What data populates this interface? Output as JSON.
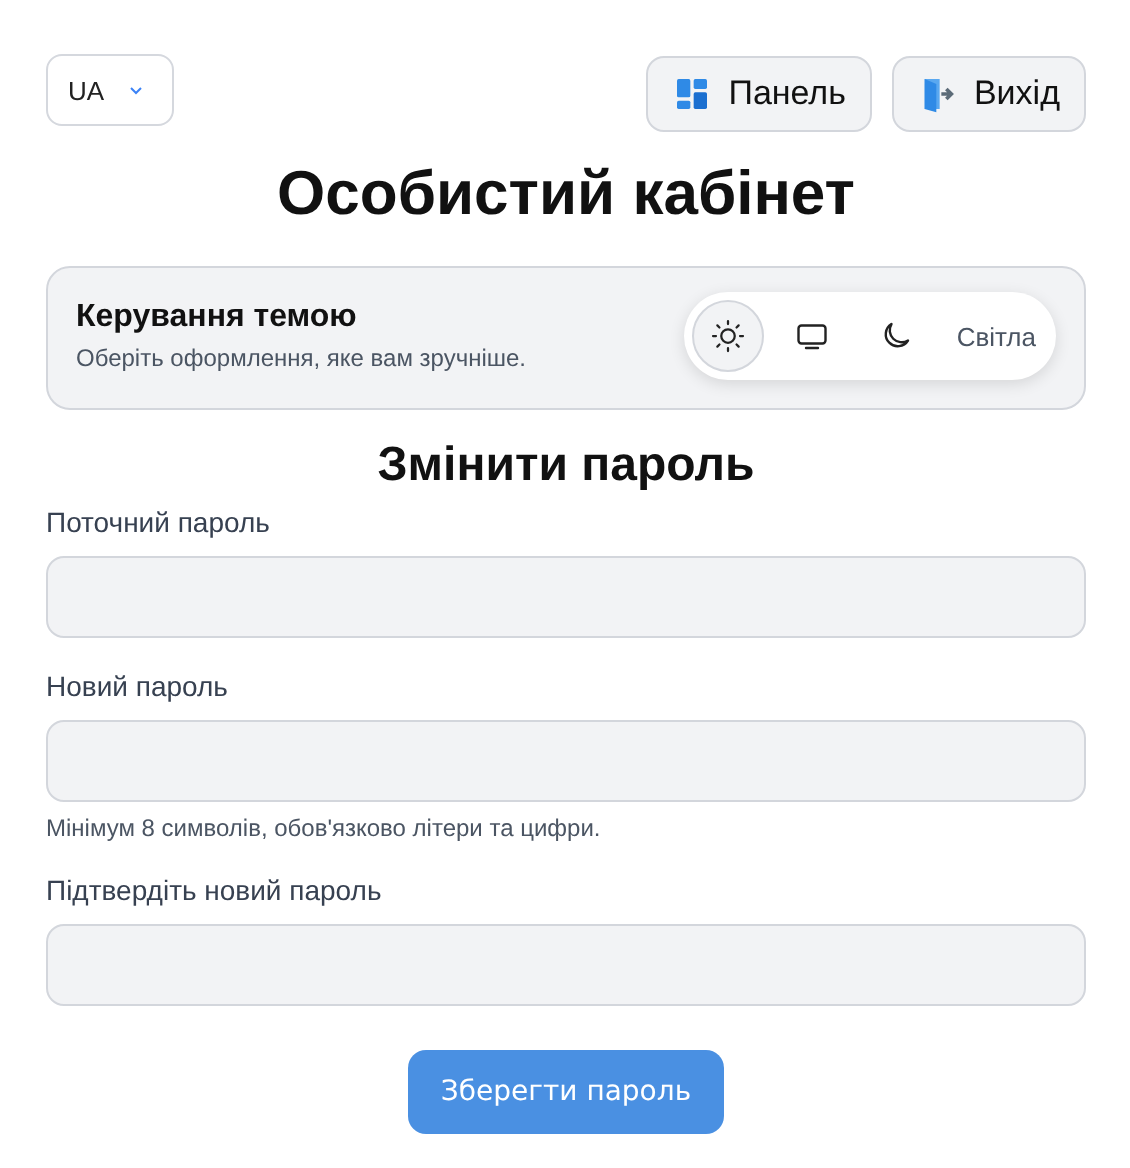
{
  "language": {
    "value": "UA"
  },
  "nav_buttons": [
    {
      "kind": "panel",
      "label": "Панель"
    },
    {
      "kind": "exit",
      "label": "Вихід"
    }
  ],
  "title": "Особистий кабінет",
  "theme": {
    "title": "Керування темою",
    "subtitle": "Оберіть оформлення, яке вам зручніше.",
    "current": "Світла",
    "options": [
      {
        "kind": "sun",
        "selected": true
      },
      {
        "kind": "monitor",
        "selected": false
      },
      {
        "kind": "moon",
        "selected": false
      }
    ]
  },
  "password_form": {
    "title": "Змінити пароль",
    "fields": [
      {
        "label": "Поточний пароль"
      },
      {
        "label": "Новий пароль",
        "hint": "Мінімум 8 символів, обов'язково літери та цифри."
      },
      {
        "label": "Підтвердіть новий пароль"
      }
    ],
    "submit": "Зберегти пароль"
  }
}
